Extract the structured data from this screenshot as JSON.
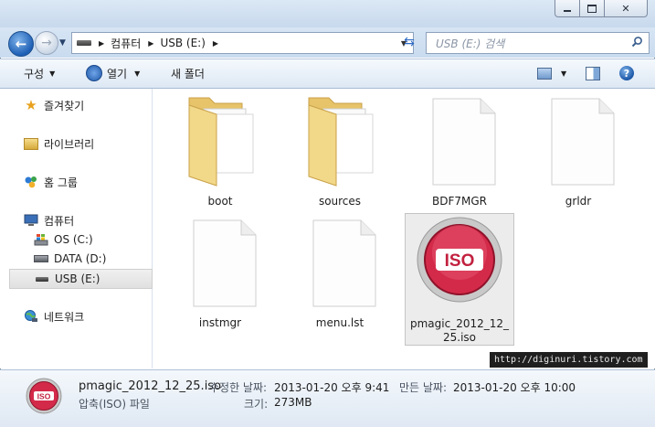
{
  "window": {
    "caption_buttons": [
      "minimize",
      "maximize",
      "close"
    ]
  },
  "address": {
    "crumbs": [
      "컴퓨터",
      "USB (E:)"
    ],
    "search_placeholder": "USB (E:) 검색"
  },
  "toolbar": {
    "organize": "구성",
    "open": "열기",
    "new_folder": "새 폴더"
  },
  "sidebar": {
    "favorites": "즐겨찾기",
    "libraries": "라이브러리",
    "homegroup": "홈 그룹",
    "computer": "컴퓨터",
    "drives": [
      "OS (C:)",
      "DATA (D:)",
      "USB (E:)"
    ],
    "network": "네트워크"
  },
  "files": [
    {
      "name": "boot",
      "type": "folder"
    },
    {
      "name": "sources",
      "type": "folder"
    },
    {
      "name": "BDF7MGR",
      "type": "file"
    },
    {
      "name": "grldr",
      "type": "file"
    },
    {
      "name": "instmgr",
      "type": "file"
    },
    {
      "name": "menu.lst",
      "type": "file"
    },
    {
      "name": "pmagic_2012_12_25.iso",
      "type": "iso",
      "selected": true
    }
  ],
  "iso_label": "ISO",
  "details": {
    "filename": "pmagic_2012_12_25.iso",
    "type": "압축(ISO) 파일",
    "modified_label": "수정한 날짜:",
    "modified": "2013-01-20 오후 9:41",
    "created_label": "만든 날짜:",
    "created": "2013-01-20 오후 10:00",
    "size_label": "크기:",
    "size": "273MB"
  },
  "watermark": "http://diginuri.tistory.com",
  "colors": {
    "accent": "#1e5fb5",
    "iso_red": "#d42a4a",
    "folder": "#f0d27a"
  }
}
